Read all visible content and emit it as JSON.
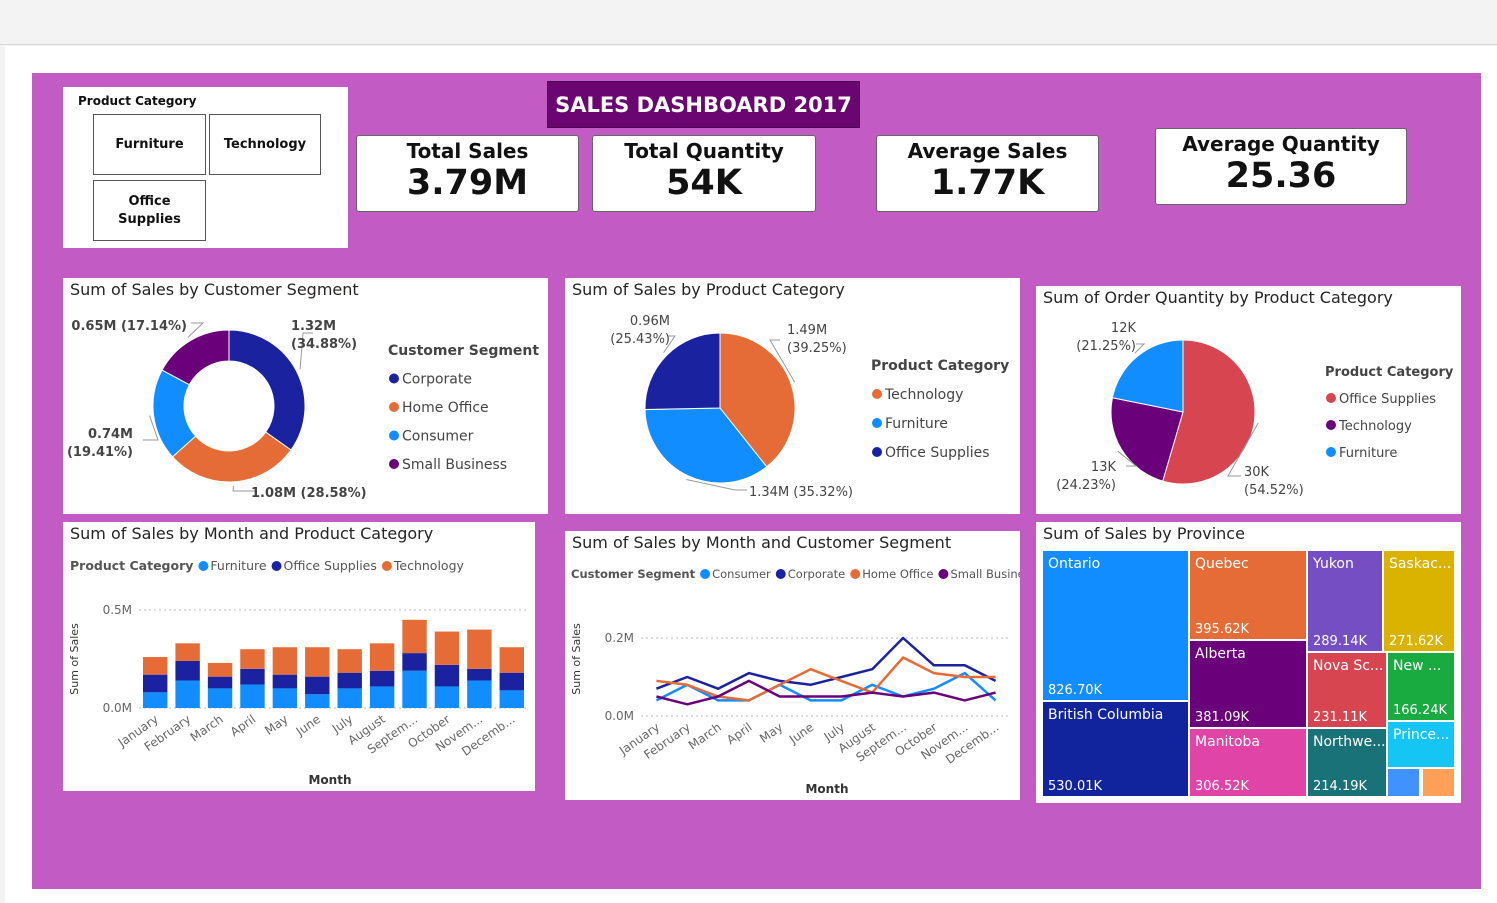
{
  "dashboard": {
    "title": "SALES DASHBOARD 2017",
    "colors": {
      "background": "#c25bc4",
      "banner": "#6a0572"
    }
  },
  "slicer": {
    "title": "Product Category",
    "options": [
      "Furniture",
      "Technology",
      "Office Supplies"
    ]
  },
  "kpis": [
    {
      "label": "Total Sales",
      "value": "3.79M"
    },
    {
      "label": "Total Quantity",
      "value": "54K"
    },
    {
      "label": "Average Sales",
      "value": "1.77K"
    },
    {
      "label": "Average Quantity",
      "value": "25.36"
    }
  ],
  "chart_data": [
    {
      "type": "pie",
      "variant": "donut",
      "title": "Sum of Sales by Customer Segment",
      "legend_title": "Customer Segment",
      "legend_position": "right",
      "slices": [
        {
          "name": "Corporate",
          "value": 1.32,
          "label": "1.32M",
          "pct": "(34.88%)",
          "color": "#1a22a0"
        },
        {
          "name": "Home Office",
          "value": 1.08,
          "label": "1.08M (28.58%)",
          "pct": "",
          "color": "#e66c37"
        },
        {
          "name": "Consumer",
          "value": 0.74,
          "label": "0.74M",
          "pct": "(19.41%)",
          "color": "#118dff"
        },
        {
          "name": "Small Business",
          "value": 0.65,
          "label": "0.65M (17.14%)",
          "pct": "",
          "color": "#6b007b"
        }
      ]
    },
    {
      "type": "pie",
      "title": "Sum of Sales by Product Category",
      "legend_title": "Product Category",
      "legend_position": "right",
      "slices": [
        {
          "name": "Technology",
          "value": 1.49,
          "label": "1.49M",
          "pct": "(39.25%)",
          "color": "#e66c37"
        },
        {
          "name": "Furniture",
          "value": 1.34,
          "label": "1.34M (35.32%)",
          "pct": "",
          "color": "#118dff"
        },
        {
          "name": "Office Supplies",
          "value": 0.96,
          "label": "0.96M",
          "pct": "(25.43%)",
          "color": "#1a22a0"
        }
      ]
    },
    {
      "type": "pie",
      "title": "Sum of Order Quantity by Product Category",
      "legend_title": "Product Category",
      "legend_position": "right",
      "slices": [
        {
          "name": "Office Supplies",
          "value": 30,
          "label": "30K",
          "pct": "(54.52%)",
          "color": "#d64550"
        },
        {
          "name": "Technology",
          "value": 13,
          "label": "13K",
          "pct": "(24.23%)",
          "color": "#6b007b"
        },
        {
          "name": "Furniture",
          "value": 12,
          "label": "12K",
          "pct": "(21.25%)",
          "color": "#118dff"
        }
      ]
    },
    {
      "type": "bar",
      "stacked": true,
      "title": "Sum of Sales by Month and Product Category",
      "legend_title": "Product Category",
      "xlabel": "Month",
      "ylabel": "Sum of Sales",
      "ylim": [
        0,
        0.5
      ],
      "yticks": [
        "0.0M",
        "0.5M"
      ],
      "categories": [
        "January",
        "February",
        "March",
        "April",
        "May",
        "June",
        "July",
        "August",
        "Septem...",
        "October",
        "Novem...",
        "Decemb..."
      ],
      "series": [
        {
          "name": "Furniture",
          "color": "#118dff",
          "values": [
            0.08,
            0.14,
            0.1,
            0.12,
            0.1,
            0.07,
            0.1,
            0.11,
            0.19,
            0.11,
            0.14,
            0.09
          ]
        },
        {
          "name": "Office Supplies",
          "color": "#1a22a0",
          "values": [
            0.09,
            0.1,
            0.06,
            0.08,
            0.07,
            0.09,
            0.08,
            0.08,
            0.09,
            0.11,
            0.06,
            0.09
          ]
        },
        {
          "name": "Technology",
          "color": "#e66c37",
          "values": [
            0.09,
            0.09,
            0.07,
            0.1,
            0.14,
            0.15,
            0.12,
            0.14,
            0.17,
            0.17,
            0.2,
            0.13
          ]
        }
      ]
    },
    {
      "type": "line",
      "title": "Sum of Sales by Month and Customer Segment",
      "legend_title": "Customer Segment",
      "xlabel": "Month",
      "ylabel": "Sum of Sales",
      "ylim": [
        0,
        0.2
      ],
      "yticks": [
        "0.0M",
        "0.2M"
      ],
      "categories": [
        "January",
        "February",
        "March",
        "April",
        "May",
        "June",
        "July",
        "August",
        "Septem...",
        "October",
        "Novem...",
        "Decemb..."
      ],
      "series": [
        {
          "name": "Consumer",
          "color": "#118dff",
          "values": [
            0.04,
            0.08,
            0.04,
            0.04,
            0.08,
            0.04,
            0.04,
            0.08,
            0.05,
            0.07,
            0.11,
            0.04
          ]
        },
        {
          "name": "Corporate",
          "color": "#1a22a0",
          "values": [
            0.07,
            0.1,
            0.07,
            0.11,
            0.09,
            0.08,
            0.1,
            0.12,
            0.2,
            0.13,
            0.13,
            0.09
          ]
        },
        {
          "name": "Home Office",
          "color": "#e66c37",
          "values": [
            0.09,
            0.08,
            0.05,
            0.04,
            0.08,
            0.12,
            0.09,
            0.06,
            0.15,
            0.11,
            0.1,
            0.1
          ]
        },
        {
          "name": "Small Business",
          "color": "#6b007b",
          "values": [
            0.05,
            0.03,
            0.05,
            0.09,
            0.05,
            0.05,
            0.05,
            0.06,
            0.05,
            0.06,
            0.04,
            0.06
          ]
        }
      ]
    },
    {
      "type": "treemap",
      "title": "Sum of Sales by Province",
      "items": [
        {
          "name": "Ontario",
          "value": "826.70K",
          "color": "#118dff"
        },
        {
          "name": "British Columbia",
          "value": "530.01K",
          "color": "#12239e"
        },
        {
          "name": "Quebec",
          "value": "395.62K",
          "color": "#e66c37"
        },
        {
          "name": "Alberta",
          "value": "381.09K",
          "color": "#6b007b"
        },
        {
          "name": "Manitoba",
          "value": "306.52K",
          "color": "#e044a7"
        },
        {
          "name": "Yukon",
          "value": "289.14K",
          "color": "#744ec2"
        },
        {
          "name": "Saskac...",
          "value": "271.62K",
          "color": "#d9b300"
        },
        {
          "name": "Nova Sc...",
          "value": "231.11K",
          "color": "#d64550"
        },
        {
          "name": "New ...",
          "value": "166.24K",
          "color": "#1aab40"
        },
        {
          "name": "Northwe...",
          "value": "214.19K",
          "color": "#197278"
        },
        {
          "name": "Prince...",
          "value": "",
          "color": "#15c6f4"
        },
        {
          "name": "",
          "value": "",
          "color": "#4092ff"
        },
        {
          "name": "",
          "value": "",
          "color": "#ffa058"
        }
      ]
    }
  ]
}
